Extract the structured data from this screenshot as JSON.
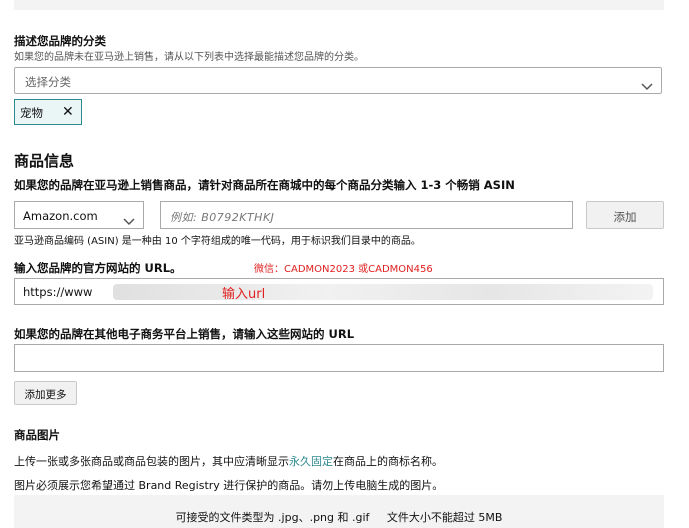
{
  "category": {
    "heading": "描述您品牌的分类",
    "subtext": "如果您的品牌未在亚马逊上销售，请从以下列表中选择最能描述您品牌的分类。",
    "placeholder": "选择分类",
    "selected_tag": "宠物",
    "remove_symbol": "✕"
  },
  "product_info": {
    "heading": "商品信息",
    "asin_prompt": "如果您的品牌在亚马逊上销售商品，请针对商品所在商城中的每个商品分类输入 1-3 个畅销 ASIN",
    "marketplace_value": "Amazon.com",
    "asin_placeholder": "例如:   B0792KTHKJ",
    "add_label": "添加",
    "asin_help": "亚马逊商品编码 (ASIN) 是一种由 10 个字符组成的唯一代码，用于标识我们目录中的商品。"
  },
  "website": {
    "label": "输入您品牌的官方网站的 URL。",
    "watermark": "微信：CADMON2023 或CADMON456",
    "value": "https://www",
    "annotation": "输入url"
  },
  "other_sites": {
    "label": "如果您的品牌在其他电子商务平台上销售，请输入这些网站的 URL",
    "value": "",
    "add_more_label": "添加更多"
  },
  "images": {
    "heading": "商品图片",
    "line1_before": "上传一张或多张商品或商品包装的图片，其中应清晰显示",
    "line1_link": "永久固定",
    "line1_after": "在商品上的商标名称。",
    "line2": "图片必须展示您希望通过 Brand Registry 进行保护的商品。请勿上传电脑生成的图片。",
    "upload_note": "可接受的文件类型为 .jpg、.png 和 .gif     文件大小不能超过 5MB"
  }
}
